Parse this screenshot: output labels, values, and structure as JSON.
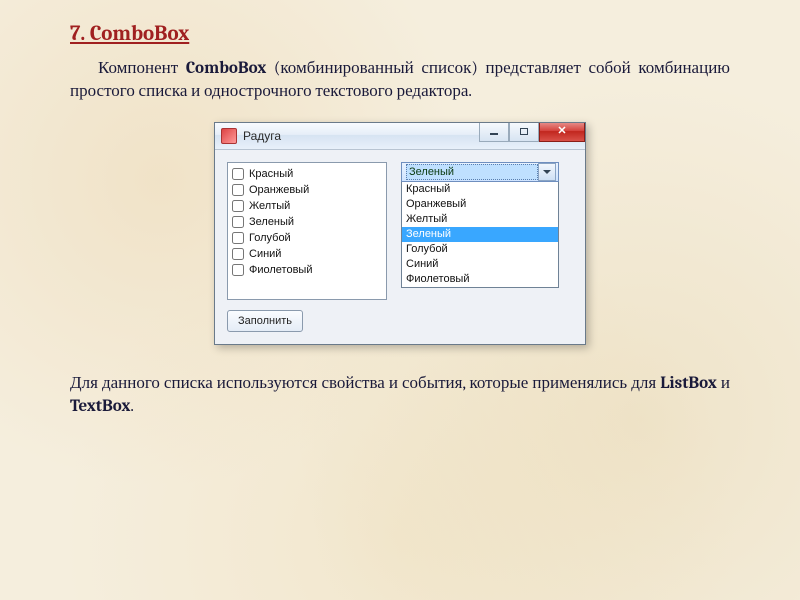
{
  "heading": "7. ComboBox",
  "para1_a": "Компонент ",
  "para1_b": "ComboBox",
  "para1_c": " (комбинированный список) представляет собой комбинацию простого списка и однострочного текстового редактора.",
  "para2_a": "Для данного списка используются свойства и события, которые применялись для ",
  "para2_b": "ListBox",
  "para2_c": " и ",
  "para2_d": "TextBox",
  "para2_e": ".",
  "window": {
    "title": "Радуга",
    "checklist": [
      "Красный",
      "Оранжевый",
      "Желтый",
      "Зеленый",
      "Голубой",
      "Синий",
      "Фиолетовый"
    ],
    "combo_selected": "Зеленый",
    "dropdown": [
      "Красный",
      "Оранжевый",
      "Желтый",
      "Зеленый",
      "Голубой",
      "Синий",
      "Фиолетовый"
    ],
    "dropdown_highlight_index": 3,
    "fill_button": "Заполнить"
  }
}
